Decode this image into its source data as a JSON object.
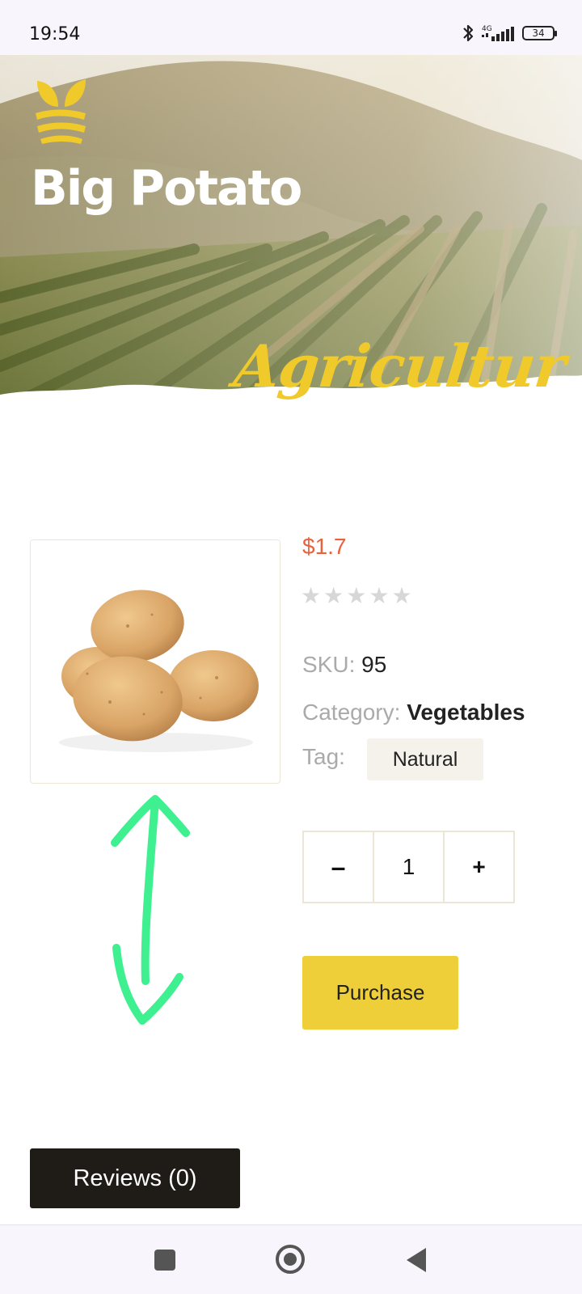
{
  "status_bar": {
    "time": "19:54",
    "network": "4G",
    "battery": "34"
  },
  "hero": {
    "title": "Big Potato",
    "script_text": "Agricultur",
    "accent_color": "#f0c92b"
  },
  "product": {
    "image_icon": "potatoes-image",
    "price": "$1.7",
    "rating": {
      "stars_filled": 0,
      "stars_total": 5
    },
    "sku_label": "SKU:",
    "sku_value": "95",
    "category_label": "Category:",
    "category_value": "Vegetables",
    "tag_label": "Tag:",
    "tag_value": "Natural",
    "price_color": "#e8623c"
  },
  "quantity": {
    "minus": "–",
    "value": "1",
    "plus": "+"
  },
  "actions": {
    "purchase": "Purchase",
    "purchase_color": "#eecf39"
  },
  "tabs": {
    "reviews": "Reviews (0)"
  },
  "annotation": {
    "icon": "double-arrow-icon",
    "color": "#3ef08f"
  },
  "nav_bar": {
    "icons": [
      "recents-icon",
      "home-icon",
      "back-icon"
    ]
  }
}
